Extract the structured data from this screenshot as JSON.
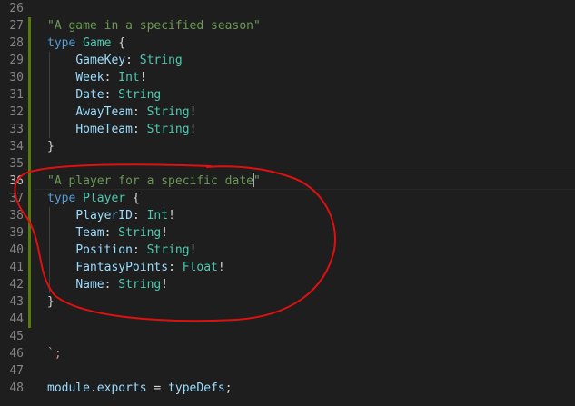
{
  "line_numbers": [
    "26",
    "27",
    "28",
    "29",
    "30",
    "31",
    "32",
    "33",
    "34",
    "35",
    "36",
    "37",
    "38",
    "39",
    "40",
    "41",
    "42",
    "43",
    "44",
    "45",
    "46",
    "47",
    "48"
  ],
  "active_line_number": "36",
  "code": {
    "l27_desc": "\"A game in a specified season\"",
    "type_keyword": "type",
    "game_name": "Game",
    "open_brace": "{",
    "close_brace": "}",
    "game_fields": [
      {
        "name": "GameKey",
        "colon": ":",
        "type": "String",
        "bang": ""
      },
      {
        "name": "Week",
        "colon": ":",
        "type": "Int",
        "bang": "!"
      },
      {
        "name": "Date",
        "colon": ":",
        "type": "String",
        "bang": ""
      },
      {
        "name": "AwayTeam",
        "colon": ":",
        "type": "String",
        "bang": "!"
      },
      {
        "name": "HomeTeam",
        "colon": ":",
        "type": "String",
        "bang": "!"
      }
    ],
    "l36_desc_before_cursor": "\"A player for a specific date",
    "l36_desc_after_cursor": "\"",
    "player_name": "Player",
    "player_fields": [
      {
        "name": "PlayerID",
        "colon": ":",
        "type": "Int",
        "bang": "!"
      },
      {
        "name": "Team",
        "colon": ":",
        "type": "String",
        "bang": "!"
      },
      {
        "name": "Position",
        "colon": ":",
        "type": "String",
        "bang": "!"
      },
      {
        "name": "FantasyPoints",
        "colon": ":",
        "type": "Float",
        "bang": "!"
      },
      {
        "name": "Name",
        "colon": ":",
        "type": "String",
        "bang": "!"
      }
    ],
    "l46": "`;",
    "l48_module": "module",
    "l48_dot": ".",
    "l48_exports": "exports",
    "l48_eq": " = ",
    "l48_typedefs": "typeDefs",
    "l48_semi": ";"
  },
  "colors": {
    "background": "#1e1e1e",
    "modified_bar": "#587c0c",
    "annotation": "#e01010"
  }
}
